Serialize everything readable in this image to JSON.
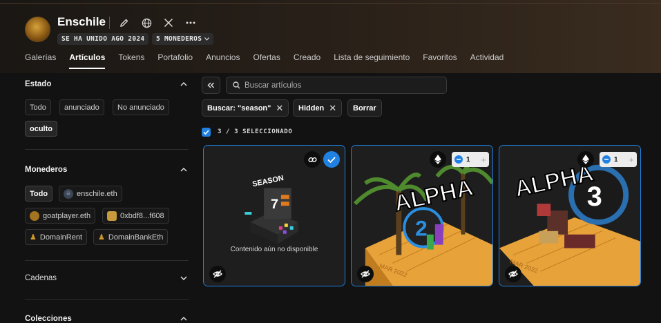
{
  "profile": {
    "name": "Enschile",
    "joined": "SE HA UNIDO AGO 2024",
    "wallets_count": "5 MONEDEROS"
  },
  "tabs": [
    "Galerías",
    "Artículos",
    "Tokens",
    "Portafolio",
    "Anuncios",
    "Ofertas",
    "Creado",
    "Lista de seguimiento",
    "Favoritos",
    "Actividad"
  ],
  "active_tab": "Artículos",
  "sidebar": {
    "estado": {
      "title": "Estado",
      "options": [
        "Todo",
        "anunciado",
        "No anunciado",
        "oculto"
      ],
      "selected": "oculto"
    },
    "monederos": {
      "title": "Monederos",
      "options": [
        "Todo",
        "enschile.eth",
        "goatplayer.eth",
        "0xbdf8...f608",
        "DomainRent",
        "DomainBankEth"
      ],
      "selected": "Todo"
    },
    "cadenas": {
      "title": "Cadenas"
    },
    "colecciones": {
      "title": "Colecciones"
    }
  },
  "search": {
    "placeholder": "Buscar artículos"
  },
  "filters": {
    "chips": [
      "Buscar: \"season\"",
      "Hidden"
    ],
    "clear_label": "Borrar"
  },
  "selection": {
    "label": "3 / 3 SELECCIONADO"
  },
  "cards": [
    {
      "chain_icon": "chain-link-icon",
      "status": "Contenido aún no disponible",
      "selected": true
    },
    {
      "chain_icon": "ethereum-icon",
      "quantity": "1"
    },
    {
      "chain_icon": "ethereum-icon",
      "quantity": "1"
    }
  ],
  "colors": {
    "accent": "#2081e2",
    "background": "#121212"
  }
}
